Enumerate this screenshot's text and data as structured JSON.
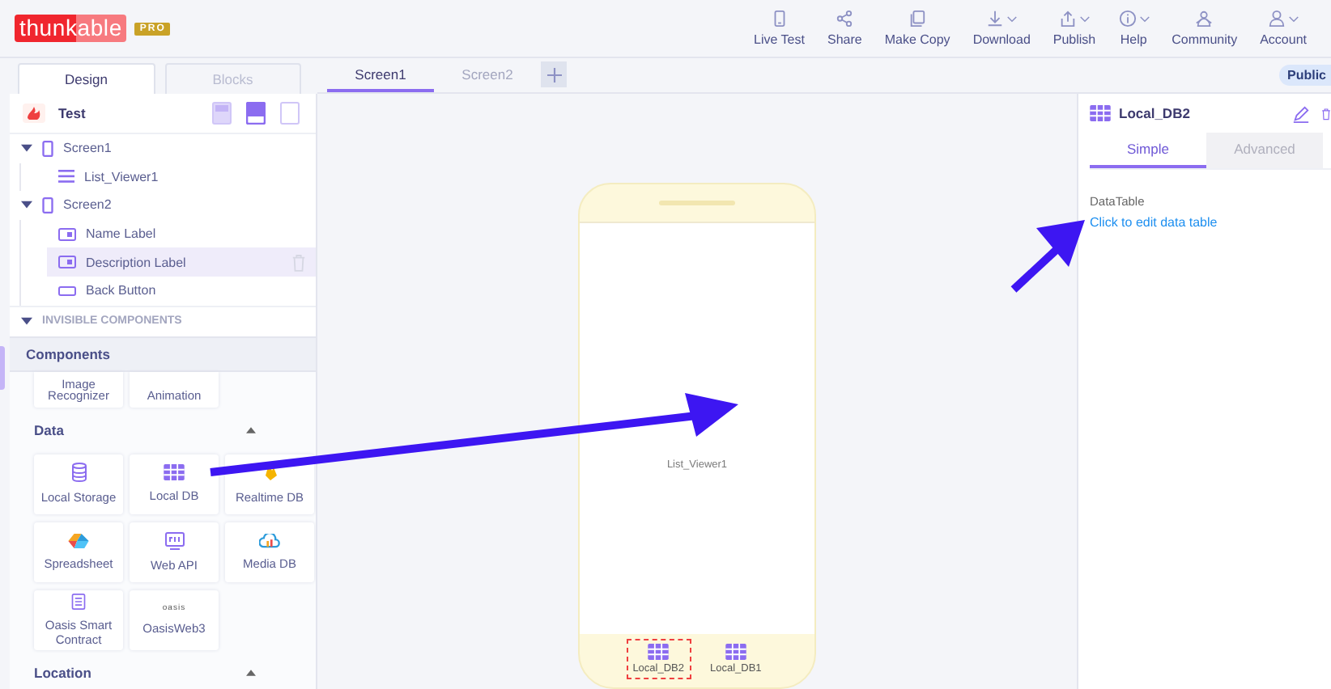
{
  "app": {
    "logo": "thunkable",
    "badge": "PRO"
  },
  "toolbar": [
    {
      "label": "Live Test",
      "kind": "phone",
      "dropdown": false
    },
    {
      "label": "Share",
      "kind": "share",
      "dropdown": false
    },
    {
      "label": "Make Copy",
      "kind": "copy",
      "dropdown": false
    },
    {
      "label": "Download",
      "kind": "download",
      "dropdown": true
    },
    {
      "label": "Publish",
      "kind": "publish",
      "dropdown": true
    },
    {
      "label": "Help",
      "kind": "info",
      "dropdown": true
    },
    {
      "label": "Community",
      "kind": "community",
      "dropdown": false
    },
    {
      "label": "Account",
      "kind": "person",
      "dropdown": true
    }
  ],
  "mode_tabs": [
    {
      "label": "Design",
      "selected": true
    },
    {
      "label": "Blocks",
      "selected": false
    }
  ],
  "screen_tabs": [
    {
      "label": "Screen1",
      "selected": true
    },
    {
      "label": "Screen2",
      "selected": false
    }
  ],
  "visibility_badge": "Public",
  "project": {
    "name": "Test",
    "device_buttons": [
      {
        "kind": "tablet",
        "selected": false
      },
      {
        "kind": "phone",
        "selected": true
      },
      {
        "kind": "outline",
        "selected": false
      }
    ]
  },
  "tree": [
    {
      "label": "Screen1",
      "kind": "screen",
      "expanded": true,
      "selected": false,
      "children": [
        {
          "label": "List_Viewer1",
          "kind": "list",
          "selected": false
        }
      ]
    },
    {
      "label": "Screen2",
      "kind": "screen",
      "expanded": true,
      "selected": false,
      "children": [
        {
          "label": "Name Label",
          "kind": "label",
          "selected": false
        },
        {
          "label": "Description Label",
          "kind": "label",
          "selected": true
        },
        {
          "label": "Back Button",
          "kind": "button",
          "selected": false
        }
      ]
    }
  ],
  "invisible_components": {
    "label": "INVISIBLE COMPONENTS",
    "expanded": true
  },
  "components_header": "Components",
  "partial_tiles": [
    {
      "label": "Image Recognizer"
    },
    {
      "label": "Animation"
    }
  ],
  "sections": [
    {
      "title": "Data",
      "expanded": true,
      "tiles": [
        {
          "label": "Local Storage",
          "kind": "db"
        },
        {
          "label": "Local DB",
          "kind": "table"
        },
        {
          "label": "Realtime DB",
          "kind": "flame"
        },
        {
          "label": "Spreadsheet",
          "kind": "sheets"
        },
        {
          "label": "Web API",
          "kind": "api"
        },
        {
          "label": "Media DB",
          "kind": "cloud"
        },
        {
          "label": "Oasis Smart Contract",
          "kind": "doc"
        },
        {
          "label": "OasisWeb3",
          "kind": "wordmark",
          "logo_text": "oasis"
        }
      ]
    },
    {
      "title": "Location",
      "expanded": true
    }
  ],
  "canvas": {
    "screen_label": "List_Viewer1",
    "nonvisible": [
      {
        "label": "Local_DB2",
        "selected": true
      },
      {
        "label": "Local_DB1",
        "selected": false
      }
    ]
  },
  "properties": {
    "title": "Local_DB2",
    "tabs": [
      {
        "label": "Simple",
        "selected": true
      },
      {
        "label": "Advanced",
        "selected": false
      }
    ],
    "fields": [
      {
        "label": "DataTable",
        "link": "Click to edit data table"
      }
    ]
  }
}
